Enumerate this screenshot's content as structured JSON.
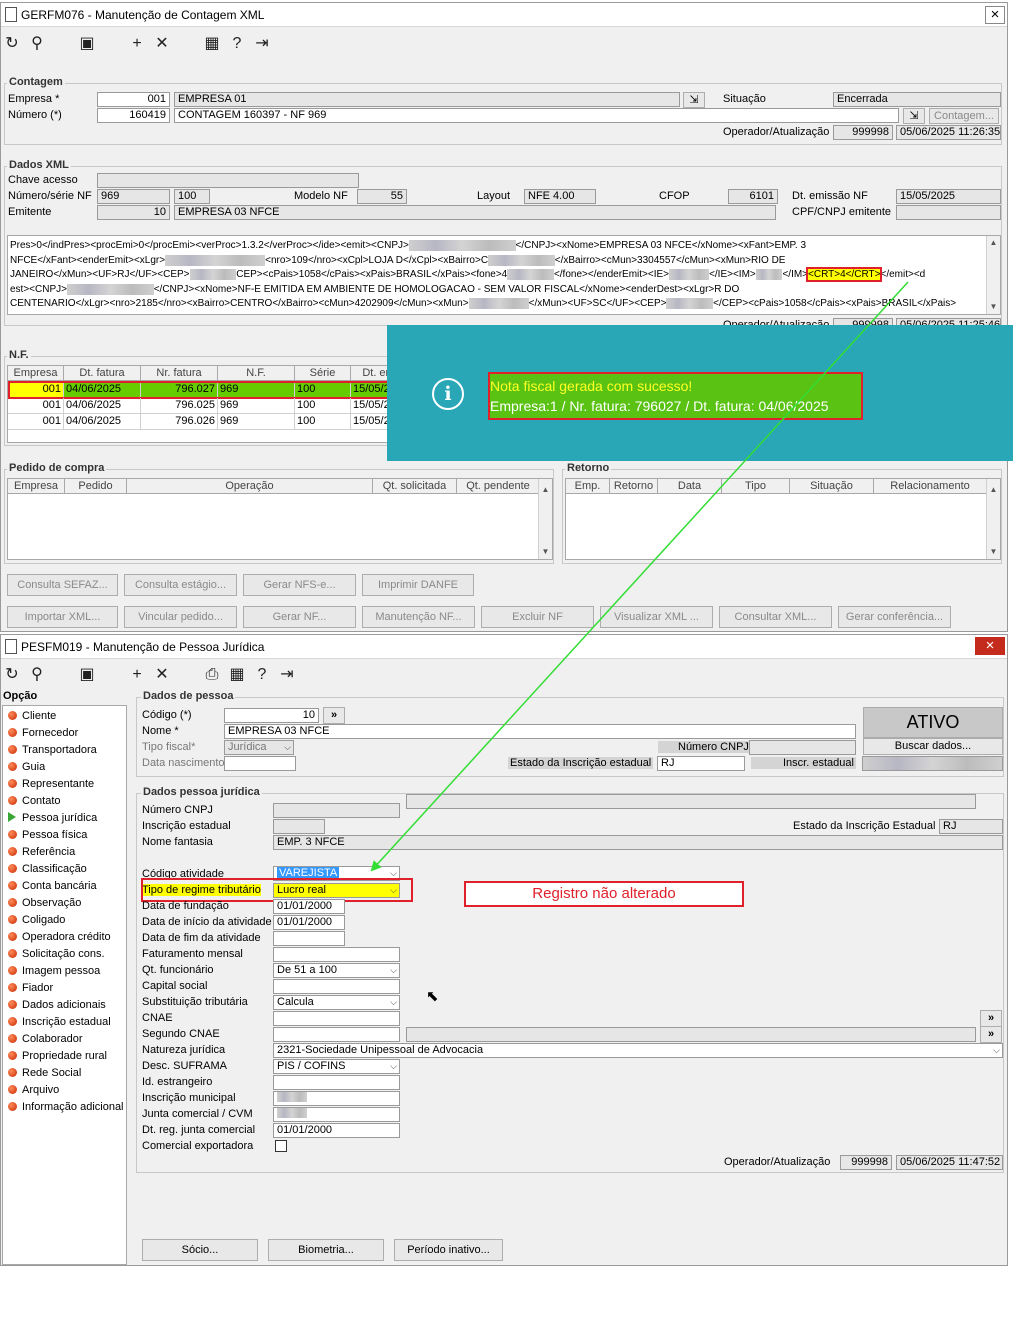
{
  "win1": {
    "title": "GERFM076 - Manutenção de Contagem XML",
    "close": "×",
    "contagem": {
      "legend": "Contagem",
      "empresa_label": "Empresa *",
      "empresa_code": "001",
      "empresa_name": "EMPRESA 01",
      "numero_label": "Número (*)",
      "numero_code": "160419",
      "numero_desc": "CONTAGEM 160397 - NF 969",
      "situacao_label": "Situação",
      "situacao_value": "Encerrada",
      "contagem_button": "Contagem...",
      "operador_label": "Operador/Atualização",
      "operador_value": "999998",
      "operador_date": "05/06/2025 11:26:35"
    },
    "xml": {
      "legend": "Dados XML",
      "chave_label": "Chave acesso",
      "numserie_label": "Número/série NF",
      "numero_nf": "969",
      "serie": "100",
      "modelo_label": "Modelo NF",
      "modelo_value": "55",
      "layout_label": "Layout",
      "layout_value": "NFE 4.00",
      "cfop_label": "CFOP",
      "cfop_value": "6101",
      "dtemissao_label": "Dt. emissão NF",
      "dtemissao_value": "15/05/2025",
      "emitente_label": "Emitente",
      "emitente_code": "10",
      "emitente_name": "EMPRESA 03 NFCE",
      "cpfcnpj_label": "CPF/CNPJ emitente",
      "text_lines": [
        "Pres>0</indPres><procEmi>0</procEmi><verProc>1.3.2</verProc></ide><emit><CNPJ>",
        "NFCE</xFant><enderEmit><xLgr>",
        "JANEIRO</xMun><UF>RJ</UF><CEP>",
        "est><CNPJ>",
        "CENTENARIO</xLgr><nro>2185</nro><xBairro>CENTRO</xBairro><cMun>4202909</cMun><xMun>"
      ],
      "line1_tail": "</CNPJ><xNome>EMPRESA 03 NFCE</xNome><xFant>EMP. 3",
      "line2_mid": "<nro>109</nro><xCpl>LOJA D</xCpl><xBairro>C",
      "line2_tail": "</xBairro><cMun>3304557</cMun><xMun>RIO DE",
      "line3_mid": "CEP><cPais>1058</cPais><xPais>BRASIL</xPais><fone>4",
      "line3_tail": "</fone></enderEmit><IE>",
      "line3_ie": "</IE><IM>",
      "line3_im": "</IM>",
      "crt": "<CRT>4</CRT>",
      "line3_end": "</emit><d",
      "line4_tail": "</CNPJ><xNome>NF-E EMITIDA EM AMBIENTE DE HOMOLOGACAO - SEM VALOR FISCAL</xNome><enderDest><xLgr>R DO",
      "line5_tail": "</xMun><UF>SC</UF><CEP>",
      "line5_end": "</CEP><cPais>1058</cPais><xPais>BRASIL</xPais>",
      "operador_label": "Operador/Atualização",
      "operador_value": "999998",
      "operador_date": "05/06/2025 11:25:46"
    },
    "nf": {
      "legend": "N.F.",
      "columns": [
        "Empresa",
        "Dt. fatura",
        "Nr. fatura",
        "N.F.",
        "Série",
        "Dt. en"
      ],
      "rows": [
        [
          "001",
          "04/06/2025",
          "796.027",
          "969",
          "100",
          "15/05/2"
        ],
        [
          "001",
          "04/06/2025",
          "796.025",
          "969",
          "100",
          "15/05/2"
        ],
        [
          "001",
          "04/06/2025",
          "796.026",
          "969",
          "100",
          "15/05/2"
        ]
      ]
    },
    "pedido": {
      "legend": "Pedido de compra",
      "columns": [
        "Empresa",
        "Pedido",
        "Operação",
        "Qt. solicitada",
        "Qt. pendente"
      ]
    },
    "retorno": {
      "legend": "Retorno",
      "columns": [
        "Emp.",
        "Retorno",
        "Data",
        "Tipo",
        "Situação",
        "Relacionamento"
      ]
    },
    "buttons_row1": [
      "Consulta SEFAZ...",
      "Consulta estágio...",
      "Gerar NFS-e...",
      "Imprimir DANFE"
    ],
    "buttons_row2": [
      "Importar XML...",
      "Vincular pedido...",
      "Gerar NF...",
      "Manutenção NF...",
      "Excluir NF",
      "Visualizar XML ...",
      "Consultar XML...",
      "Gerar conferência..."
    ]
  },
  "message": {
    "line1": "Nota fiscal gerada com sucesso!",
    "line2": "Empresa:1 / Nr. fatura: 796027 / Dt. fatura: 04/06/2025",
    "icon": "info-icon"
  },
  "win2": {
    "title": "PESFM019 - Manutenção de Pessoa Jurídica",
    "close": "×",
    "nav_title": "Opção",
    "nav_items": [
      "Cliente",
      "Fornecedor",
      "Transportadora",
      "Guia",
      "Representante",
      "Contato",
      "Pessoa jurídica",
      "Pessoa física",
      "Referência",
      "Classificação",
      "Conta bancária",
      "Observação",
      "Coligado",
      "Operadora crédito",
      "Solicitação cons.",
      "Imagem pessoa",
      "Fiador",
      "Dados adicionais",
      "Inscrição estadual",
      "Colaborador",
      "Propriedade rural",
      "Rede Social",
      "Arquivo",
      "Informação adicional"
    ],
    "pessoa": {
      "legend": "Dados de pessoa",
      "codigo_label": "Código (*)",
      "codigo_value": "10",
      "more": "»",
      "nome_label": "Nome *",
      "nome_value": "EMPRESA 03 NFCE",
      "tipo_label": "Tipo fiscal*",
      "tipo_value": "Jurídica",
      "nasc_label": "Data nascimento",
      "cnpj_label": "Número CNPJ",
      "estado_label": "Estado da Inscrição estadual",
      "estado_value": "RJ",
      "inscr_label": "Inscr. estadual",
      "status": "ATIVO",
      "buscar": "Buscar dados..."
    },
    "juridica": {
      "legend": "Dados pessoa jurídica",
      "cnpj_label": "Número CNPJ",
      "ie_label": "Inscrição estadual",
      "estado_ie_label": "Estado da Inscrição Estadual",
      "estado_ie_value": "RJ",
      "fantasia_label": "Nome fantasia",
      "fantasia_value": "EMP. 3 NFCE",
      "atividade_label": "Código atividade",
      "atividade_value": "VAREJISTA",
      "regime_label": "Tipo de regime tributário",
      "regime_value": "Lucro real",
      "fundacao_label": "Data de fundação",
      "fundacao_value": "01/01/2000",
      "inicio_label": "Data de início da atividade",
      "inicio_value": "01/01/2000",
      "fim_label": "Data de fim da atividade",
      "fat_label": "Faturamento mensal",
      "func_label": "Qt. funcionário",
      "func_value": "De 51 a 100",
      "capital_label": "Capital social",
      "subst_label": "Substituição tributária",
      "subst_value": "Calcula",
      "cnae_label": "CNAE",
      "cnae2_label": "Segundo CNAE",
      "natureza_label": "Natureza jurídica",
      "natureza_value": "2321-Sociedade Unipessoal de Advocacia",
      "suframa_label": "Desc. SUFRAMA",
      "suframa_value": "PIS / COFINS",
      "idext_label": "Id. estrangeiro",
      "im_label": "Inscrição municipal",
      "junta_label": "Junta comercial / CVM",
      "dtjunta_label": "Dt. reg. junta comercial",
      "dtjunta_value": "01/01/2000",
      "export_label": "Comercial exportadora",
      "operador_label": "Operador/Atualização",
      "operador_value": "999998",
      "operador_date": "05/06/2025 11:47:52"
    },
    "buttons": [
      "Sócio...",
      "Biometria...",
      "Período inativo..."
    ]
  },
  "annotation": {
    "text": "Registro não alterado",
    "arrow_color": "#33dd33",
    "box_color": "#e0202a"
  },
  "colors": {
    "banner": "#2aa7b7",
    "highlight_green": "#66cc00",
    "highlight_yellow": "#ffff00",
    "selection": "#3399ff"
  }
}
